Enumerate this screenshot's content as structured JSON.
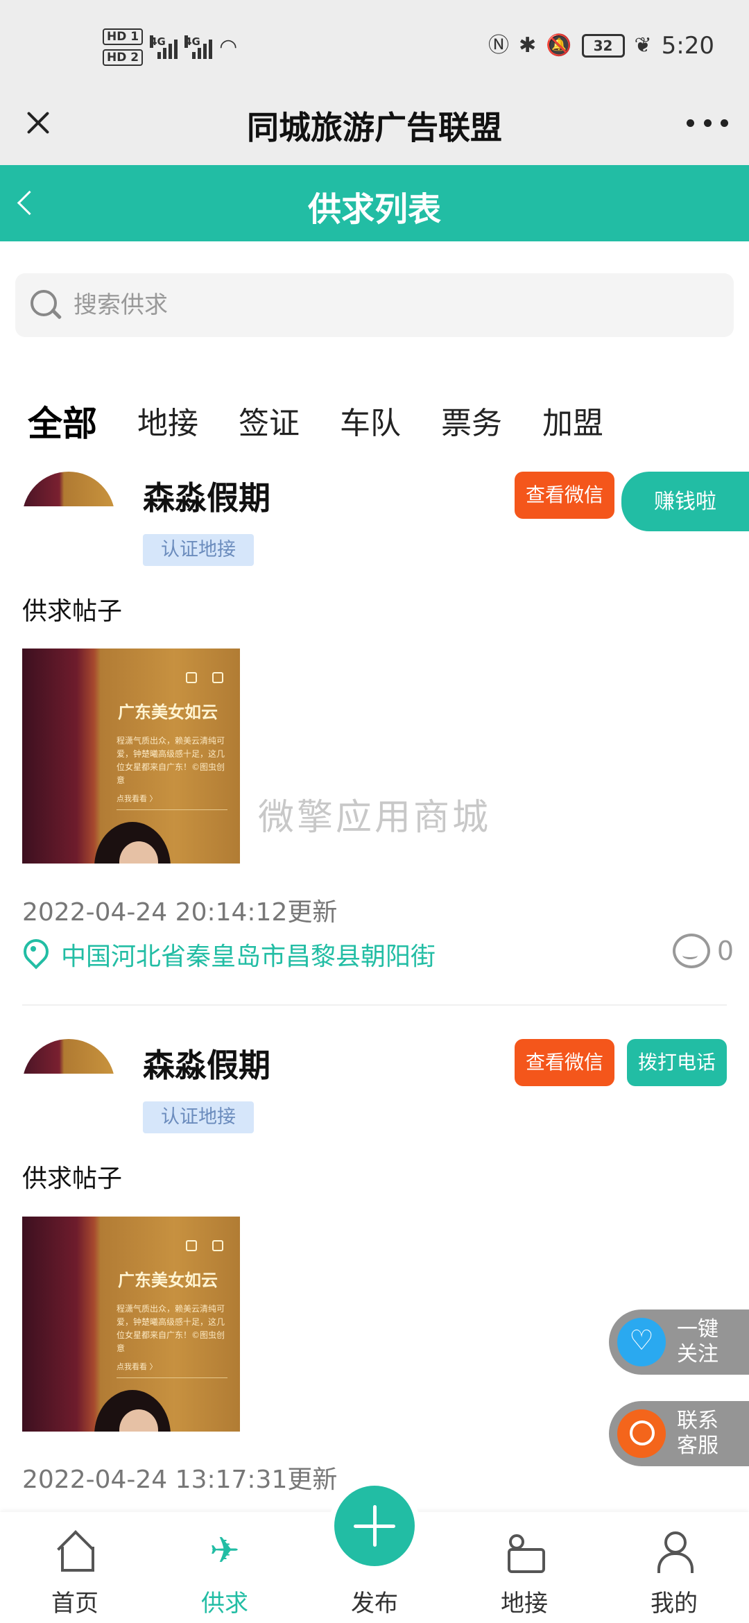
{
  "status_bar": {
    "hd1": "HD 1",
    "hd2": "HD 2",
    "net1": "4G",
    "net2": "4G",
    "battery": "32",
    "time": "5:20"
  },
  "app": {
    "title": "同城旅游广告联盟"
  },
  "page": {
    "title": "供求列表"
  },
  "search": {
    "placeholder": "搜索供求"
  },
  "tabs": [
    "全部",
    "地接",
    "签证",
    "车队",
    "票务",
    "加盟"
  ],
  "earn_tag": "赚钱啦",
  "watermark": "微擎应用商城",
  "thumb": {
    "title": "广东美女如云",
    "body": "程潇气质出众，赖美云清纯可爱，钟楚曦高级感十足，这几位女星都来自广东！©图虫创意",
    "more": "点我看看 〉"
  },
  "cards": [
    {
      "name": "森淼假期",
      "badge": "认证地接",
      "view_wechat": "查看微信",
      "post_title": "供求帖子",
      "updated": "2022-04-24 20:14:12更新",
      "location": "中国河北省秦皇岛市昌黎县朝阳街",
      "comments": "0"
    },
    {
      "name": "森淼假期",
      "badge": "认证地接",
      "view_wechat": "查看微信",
      "call": "拨打电话",
      "post_title": "供求帖子",
      "updated": "2022-04-24 13:17:31更新"
    }
  ],
  "floating": {
    "follow": "一键关注",
    "service": "联系客服"
  },
  "bottom_nav": {
    "home": "首页",
    "supply": "供求",
    "publish": "发布",
    "local": "地接",
    "mine": "我的"
  },
  "colors": {
    "accent": "#22bda4",
    "orange": "#f4561b",
    "badge_bg": "#d6e6fa"
  }
}
